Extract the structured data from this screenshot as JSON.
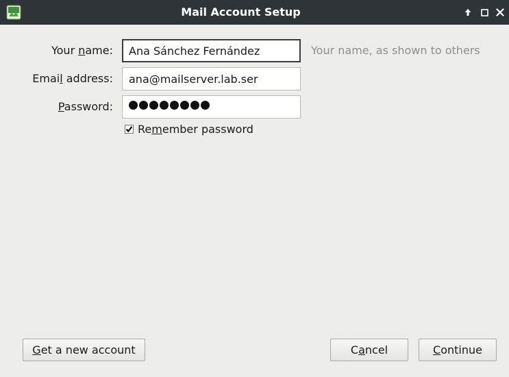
{
  "window": {
    "title": "Mail Account Setup",
    "controls": {
      "pin": "↑",
      "maximize": "□",
      "close": "✕"
    }
  },
  "form": {
    "name_label": {
      "before": "Your ",
      "accel": "n",
      "after": "ame:"
    },
    "name_value": "Ana Sánchez Fernández",
    "name_hint": "Your name, as shown to others",
    "email_label": {
      "before": "Emai",
      "accel": "l",
      "after": " address:"
    },
    "email_value": "ana@mailserver.lab.ser",
    "password_label": {
      "before": "",
      "accel": "P",
      "after": "assword:"
    },
    "password_length": 8,
    "remember": {
      "before": "Re",
      "accel": "m",
      "after": "ember password",
      "checked": true
    }
  },
  "buttons": {
    "new_account": {
      "before": "",
      "accel": "G",
      "after": "et a new account"
    },
    "cancel": {
      "before": "C",
      "accel": "a",
      "after": "ncel"
    },
    "continue": {
      "before": "",
      "accel": "C",
      "after": "ontinue"
    }
  },
  "colors": {
    "titlebar": "#2e3438",
    "background": "#ededeb",
    "hint": "#8e8e8b"
  }
}
